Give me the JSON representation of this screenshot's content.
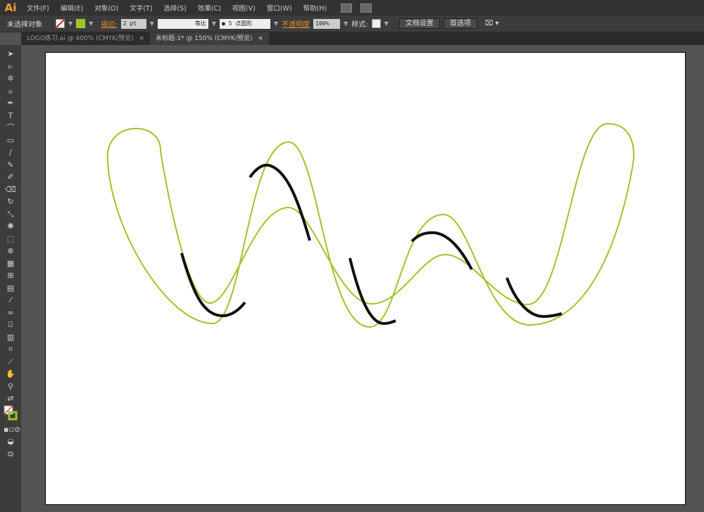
{
  "app": {
    "logo": "Ai"
  },
  "menu": [
    "文件(F)",
    "编辑(E)",
    "对象(O)",
    "文字(T)",
    "选择(S)",
    "效果(C)",
    "视图(V)",
    "窗口(W)",
    "帮助(H)"
  ],
  "control": {
    "selection": "未选择对象",
    "stroke_label": "描边:",
    "stroke_weight": "2 pt",
    "profile": "等比",
    "brush": "● 5 点圆形",
    "opacity_label": "不透明度",
    "opacity": "100%",
    "style_label": "样式:",
    "doc_setup": "文档设置",
    "preferences": "首选项"
  },
  "tabs": [
    {
      "label": "LOGO练习.ai @ 400% (CMYK/预览)",
      "close": "×"
    },
    {
      "label": "未标题-1* @ 150% (CMYK/预览)",
      "close": "×"
    }
  ],
  "colors": {
    "path": "#9dc42a",
    "highlight": "#111111",
    "accent": "#e08a30"
  }
}
